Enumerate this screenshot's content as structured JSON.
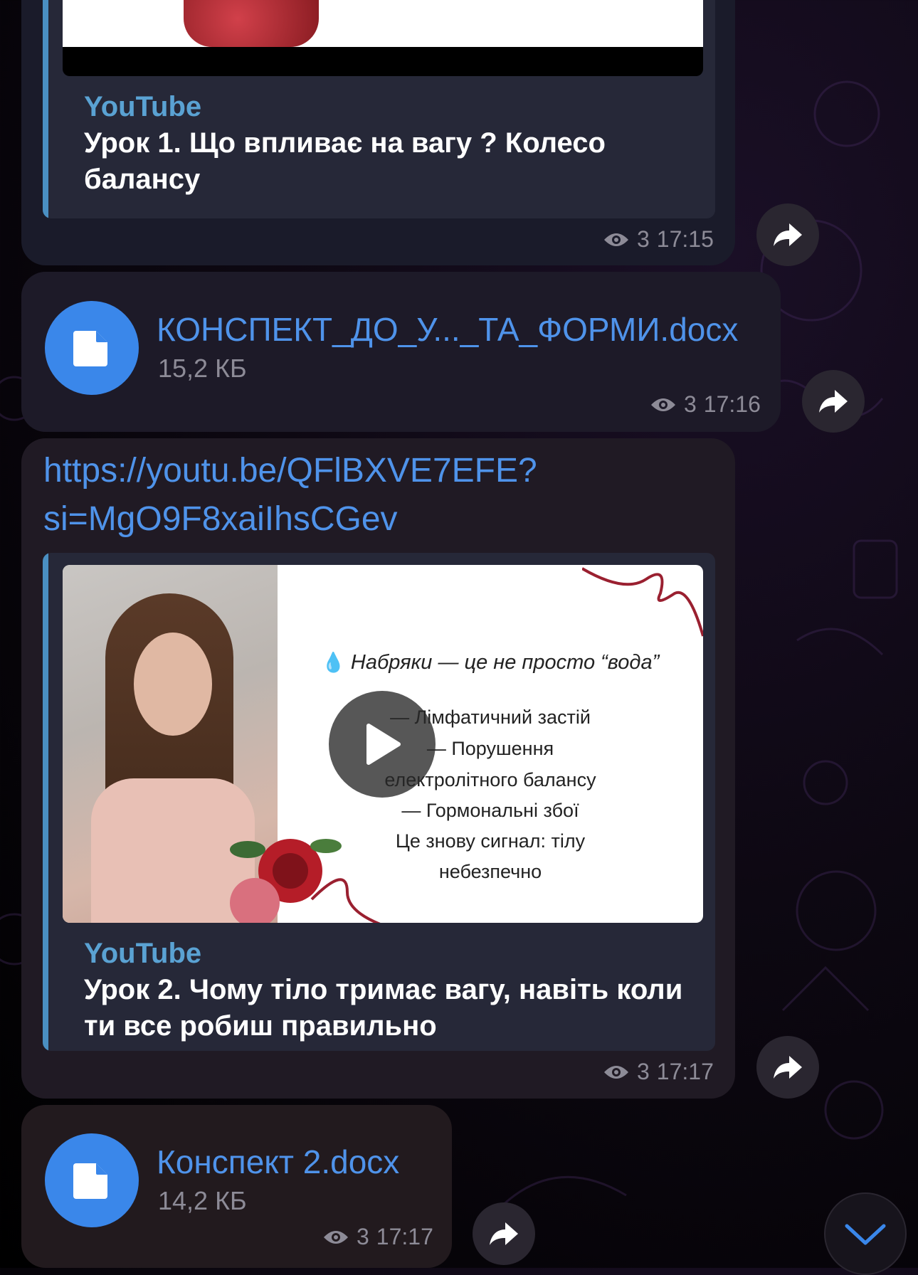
{
  "messages": [
    {
      "type": "link_preview",
      "site": "YouTube",
      "title": "Урок 1. Що впливає на вагу ? Колесо балансу",
      "views_label": "3",
      "time": "17:15"
    },
    {
      "type": "file",
      "filename": "КОНСПЕКТ_ДО_У..._ТА_ФОРМИ.docx",
      "size": "15,2 КБ",
      "views_label": "3",
      "time": "17:16"
    },
    {
      "type": "link_preview",
      "url_line1": "https://youtu.be/QFlBXVE7EFE?",
      "url_line2": "si=MgO9F8xaiIhsCGev",
      "thumbnail": {
        "title": "Набряки — це не просто “вода”",
        "lines": [
          "— Лімфатичний застій",
          "— Порушення",
          "електролітного балансу",
          "— Гормональні збої",
          "Це знову сигнал: тілу",
          "небезпечно"
        ]
      },
      "site": "YouTube",
      "title": "Урок 2. Чому тіло тримає вагу, навіть коли ти все робиш правильно",
      "views_label": "3",
      "time": "17:17"
    },
    {
      "type": "file",
      "filename": "Конспект 2.docx",
      "size": "14,2 КБ",
      "views_label": "3",
      "time": "17:17"
    }
  ],
  "icons": {
    "share": "share-arrow-icon",
    "views": "eye-icon",
    "file": "document-icon",
    "play": "play-icon",
    "scroll": "chevron-down-icon"
  },
  "colors": {
    "link": "#4f93ea",
    "site": "#5aa2d3",
    "file_circle": "#3a87ea",
    "meta": "#8d8b97"
  }
}
